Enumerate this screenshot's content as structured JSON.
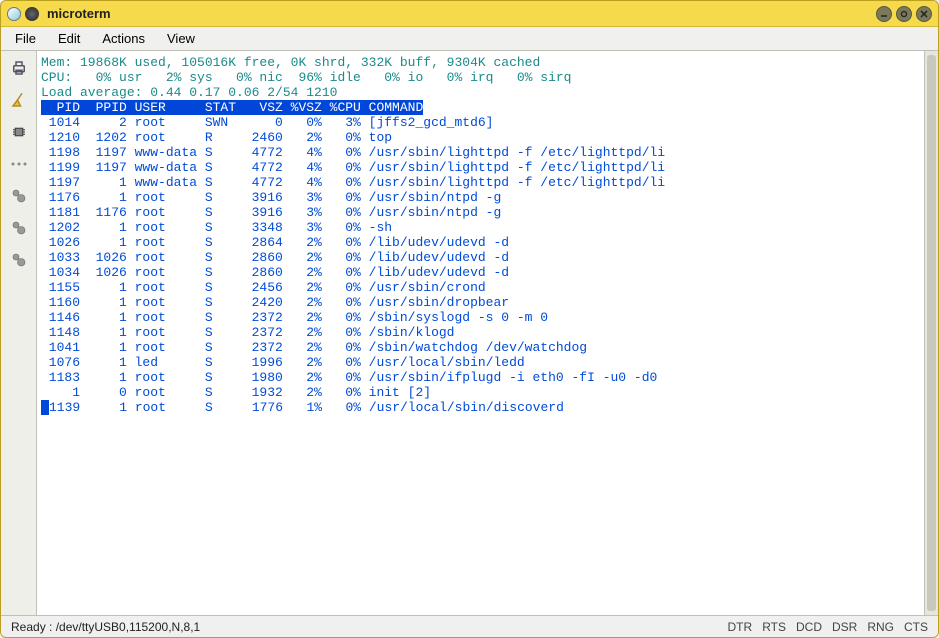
{
  "window": {
    "title": "microterm"
  },
  "menubar": {
    "items": [
      "File",
      "Edit",
      "Actions",
      "View"
    ]
  },
  "statusbar": {
    "left": "Ready : /dev/ttyUSB0,115200,N,8,1",
    "indicators": [
      "DTR",
      "RTS",
      "DCD",
      "DSR",
      "RNG",
      "CTS"
    ]
  },
  "toolbar": {
    "icons": [
      "printer-icon",
      "broom-icon",
      "chip-icon",
      "dots-icon",
      "gears1-icon",
      "gears2-icon",
      "gears3-icon"
    ]
  },
  "top_output": {
    "mem_line": "Mem: 19868K used, 105016K free, 0K shrd, 332K buff, 9304K cached",
    "cpu_line": "CPU:   0% usr   2% sys   0% nic  96% idle   0% io   0% irq   0% sirq",
    "load_line": "Load average: 0.44 0.17 0.06 2/54 1210",
    "header": "  PID  PPID USER     STAT   VSZ %VSZ %CPU COMMAND",
    "rows": [
      {
        "pid": "1014",
        "ppid": "2",
        "user": "root",
        "stat": "SWN",
        "vsz": "0",
        "pvsz": "0%",
        "pcpu": "3%",
        "cmd": "[jffs2_gcd_mtd6]"
      },
      {
        "pid": "1210",
        "ppid": "1202",
        "user": "root",
        "stat": "R",
        "vsz": "2460",
        "pvsz": "2%",
        "pcpu": "0%",
        "cmd": "top"
      },
      {
        "pid": "1198",
        "ppid": "1197",
        "user": "www-data",
        "stat": "S",
        "vsz": "4772",
        "pvsz": "4%",
        "pcpu": "0%",
        "cmd": "/usr/sbin/lighttpd -f /etc/lighttpd/li"
      },
      {
        "pid": "1199",
        "ppid": "1197",
        "user": "www-data",
        "stat": "S",
        "vsz": "4772",
        "pvsz": "4%",
        "pcpu": "0%",
        "cmd": "/usr/sbin/lighttpd -f /etc/lighttpd/li"
      },
      {
        "pid": "1197",
        "ppid": "1",
        "user": "www-data",
        "stat": "S",
        "vsz": "4772",
        "pvsz": "4%",
        "pcpu": "0%",
        "cmd": "/usr/sbin/lighttpd -f /etc/lighttpd/li"
      },
      {
        "pid": "1176",
        "ppid": "1",
        "user": "root",
        "stat": "S",
        "vsz": "3916",
        "pvsz": "3%",
        "pcpu": "0%",
        "cmd": "/usr/sbin/ntpd -g"
      },
      {
        "pid": "1181",
        "ppid": "1176",
        "user": "root",
        "stat": "S",
        "vsz": "3916",
        "pvsz": "3%",
        "pcpu": "0%",
        "cmd": "/usr/sbin/ntpd -g"
      },
      {
        "pid": "1202",
        "ppid": "1",
        "user": "root",
        "stat": "S",
        "vsz": "3348",
        "pvsz": "3%",
        "pcpu": "0%",
        "cmd": "-sh"
      },
      {
        "pid": "1026",
        "ppid": "1",
        "user": "root",
        "stat": "S",
        "vsz": "2864",
        "pvsz": "2%",
        "pcpu": "0%",
        "cmd": "/lib/udev/udevd -d"
      },
      {
        "pid": "1033",
        "ppid": "1026",
        "user": "root",
        "stat": "S",
        "vsz": "2860",
        "pvsz": "2%",
        "pcpu": "0%",
        "cmd": "/lib/udev/udevd -d"
      },
      {
        "pid": "1034",
        "ppid": "1026",
        "user": "root",
        "stat": "S",
        "vsz": "2860",
        "pvsz": "2%",
        "pcpu": "0%",
        "cmd": "/lib/udev/udevd -d"
      },
      {
        "pid": "1155",
        "ppid": "1",
        "user": "root",
        "stat": "S",
        "vsz": "2456",
        "pvsz": "2%",
        "pcpu": "0%",
        "cmd": "/usr/sbin/crond"
      },
      {
        "pid": "1160",
        "ppid": "1",
        "user": "root",
        "stat": "S",
        "vsz": "2420",
        "pvsz": "2%",
        "pcpu": "0%",
        "cmd": "/usr/sbin/dropbear"
      },
      {
        "pid": "1146",
        "ppid": "1",
        "user": "root",
        "stat": "S",
        "vsz": "2372",
        "pvsz": "2%",
        "pcpu": "0%",
        "cmd": "/sbin/syslogd -s 0 -m 0"
      },
      {
        "pid": "1148",
        "ppid": "1",
        "user": "root",
        "stat": "S",
        "vsz": "2372",
        "pvsz": "2%",
        "pcpu": "0%",
        "cmd": "/sbin/klogd"
      },
      {
        "pid": "1041",
        "ppid": "1",
        "user": "root",
        "stat": "S",
        "vsz": "2372",
        "pvsz": "2%",
        "pcpu": "0%",
        "cmd": "/sbin/watchdog /dev/watchdog"
      },
      {
        "pid": "1076",
        "ppid": "1",
        "user": "led",
        "stat": "S",
        "vsz": "1996",
        "pvsz": "2%",
        "pcpu": "0%",
        "cmd": "/usr/local/sbin/ledd"
      },
      {
        "pid": "1183",
        "ppid": "1",
        "user": "root",
        "stat": "S",
        "vsz": "1980",
        "pvsz": "2%",
        "pcpu": "0%",
        "cmd": "/usr/sbin/ifplugd -i eth0 -fI -u0 -d0"
      },
      {
        "pid": "1",
        "ppid": "0",
        "user": "root",
        "stat": "S",
        "vsz": "1932",
        "pvsz": "2%",
        "pcpu": "0%",
        "cmd": "init [2]"
      },
      {
        "pid": "1139",
        "ppid": "1",
        "user": "root",
        "stat": "S",
        "vsz": "1776",
        "pvsz": "1%",
        "pcpu": "0%",
        "cmd": "/usr/local/sbin/discoverd"
      }
    ]
  }
}
